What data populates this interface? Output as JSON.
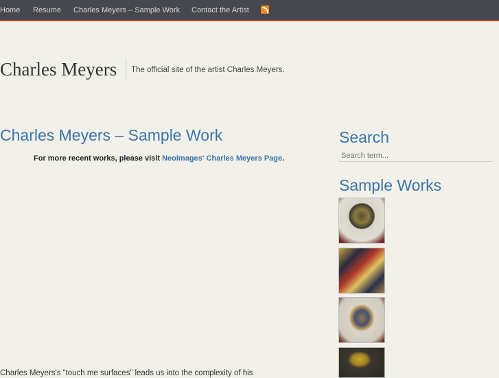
{
  "nav": {
    "items": [
      "Home",
      "Resume",
      "Charles Meyers – Sample Work",
      "Contact the Artist"
    ],
    "rss": "rss-icon"
  },
  "header": {
    "title": "Charles Meyers",
    "tagline": "The official site of the artist Charles Meyers."
  },
  "post": {
    "title": "Charles Meyers – Sample Work",
    "notice_prefix": "For more recent works, please visit ",
    "notice_link": "NeoImages' Charles Meyers Page",
    "notice_suffix": ".",
    "body": "Charles Meyers's “touch me surfaces” leads us into the complexity of his"
  },
  "sidebar": {
    "search_title": "Search",
    "search_placeholder": "Search term...",
    "works_title": "Sample Works"
  },
  "colors": {
    "accent": "#3a74a8",
    "nav_bg": "#46484d",
    "nav_border": "#c9461f"
  }
}
